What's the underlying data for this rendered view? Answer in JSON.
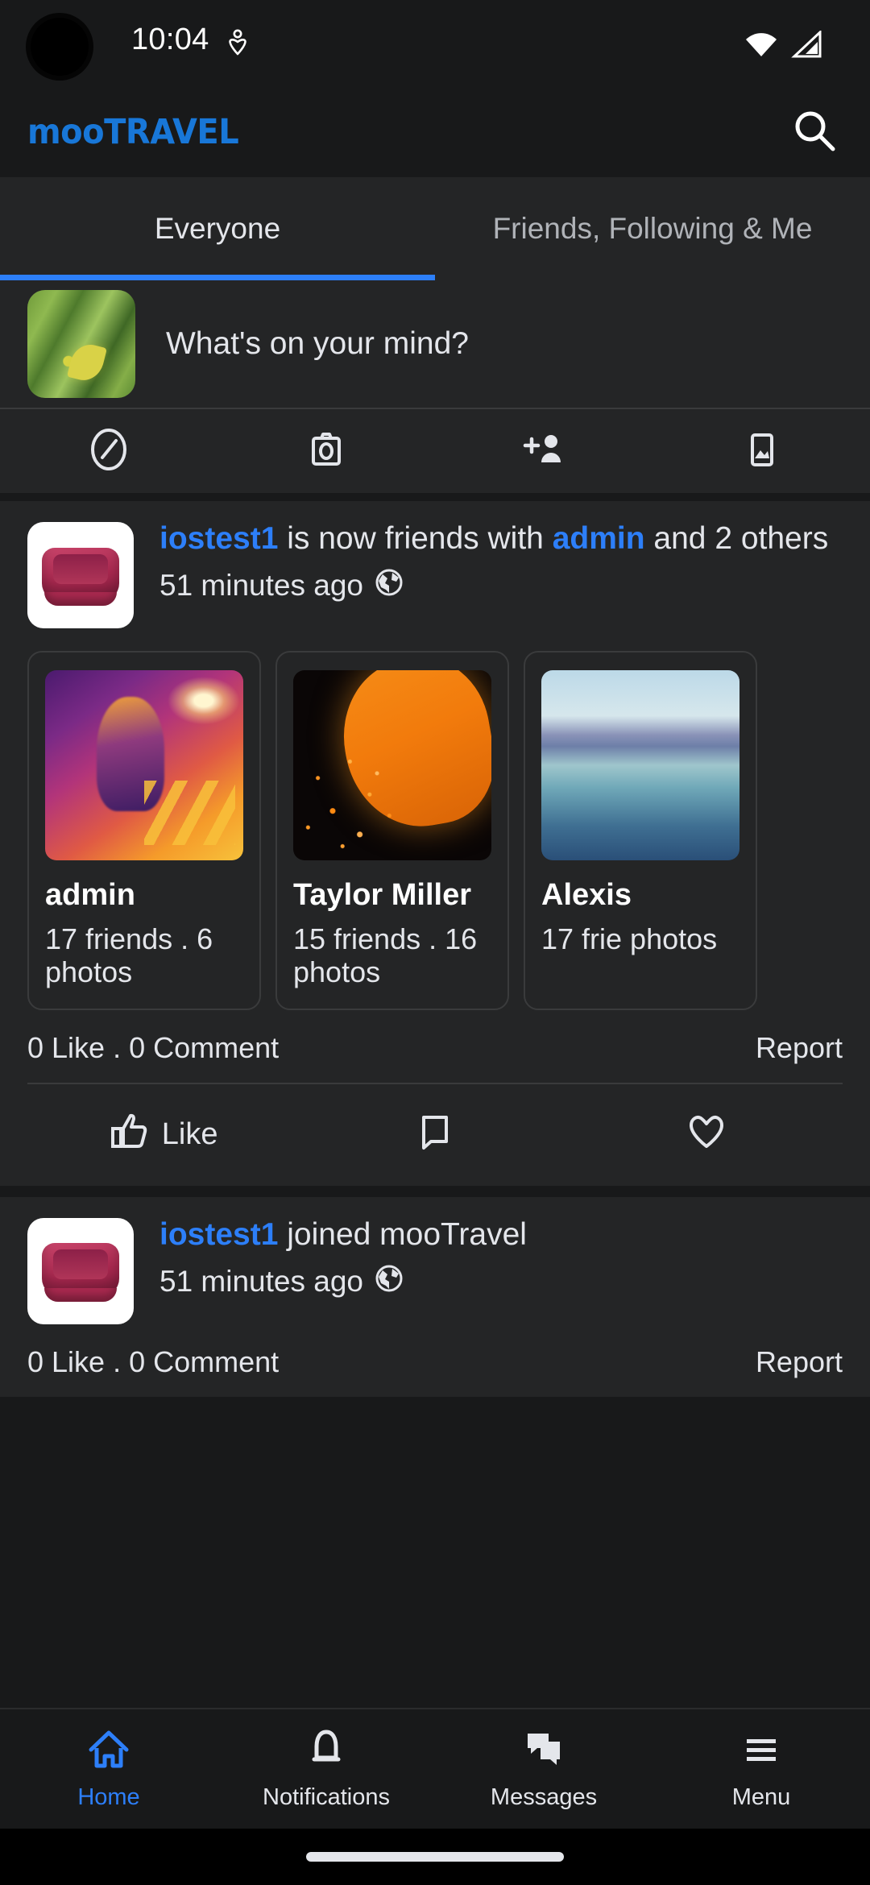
{
  "statusbar": {
    "time": "10:04",
    "location_icon": "location-sharing-icon",
    "wifi_icon": "wifi-full-icon",
    "cellular_icon": "cellular-signal-icon"
  },
  "header": {
    "logo_moo": "moo",
    "logo_travel": "TRAVEL",
    "logo_color": "#1877d8",
    "search_icon": "search-icon"
  },
  "tabs": {
    "items": [
      {
        "label": "Everyone",
        "active": true
      },
      {
        "label": "Friends, Following & Me",
        "active": false
      }
    ],
    "indicator_color": "#2d7ff9"
  },
  "composer": {
    "avatar": "user-avatar-leaves",
    "prompt": "What's on your mind?"
  },
  "quick_actions": [
    {
      "icon": "edit-pencil-circle-icon",
      "name": "write-post"
    },
    {
      "icon": "camera-icon",
      "name": "take-photo"
    },
    {
      "icon": "add-person-icon",
      "name": "add-friend"
    },
    {
      "icon": "image-icon",
      "name": "add-photo"
    }
  ],
  "posts": [
    {
      "avatar": "pet-bed-avatar",
      "actor": "iostest1",
      "text_mid": " is now friends with ",
      "target": "admin",
      "text_end": " and 2 others",
      "time": "51 minutes ago",
      "privacy_icon": "globe-icon",
      "cards": [
        {
          "name": "admin",
          "stats": "17 friends . 6 photos",
          "image": "thermal-man-phone"
        },
        {
          "name": "Taylor Miller",
          "stats": "15 friends . 16 photos",
          "image": "orange-sky-lantern"
        },
        {
          "name": "Alexis",
          "stats": "17 frie photos",
          "image": "ocean-glacier"
        }
      ],
      "counts": "0 Like . 0 Comment",
      "report": "Report",
      "reactions": [
        {
          "icon": "thumbs-up-icon",
          "label": "Like"
        },
        {
          "icon": "comment-bubble-icon",
          "label": ""
        },
        {
          "icon": "heart-icon",
          "label": ""
        }
      ]
    },
    {
      "avatar": "pet-bed-avatar",
      "actor": "iostest1",
      "text_mid": " joined mooTravel",
      "target": "",
      "text_end": "",
      "time": "51 minutes ago",
      "privacy_icon": "globe-icon",
      "counts": "0 Like . 0 Comment",
      "report": "Report"
    }
  ],
  "bottomnav": {
    "items": [
      {
        "label": "Home",
        "icon": "home-icon",
        "active": true
      },
      {
        "label": "Notifications",
        "icon": "bell-icon",
        "active": false
      },
      {
        "label": "Messages",
        "icon": "messages-icon",
        "active": false
      },
      {
        "label": "Menu",
        "icon": "hamburger-menu-icon",
        "active": false
      }
    ],
    "active_color": "#2d7ff9"
  }
}
